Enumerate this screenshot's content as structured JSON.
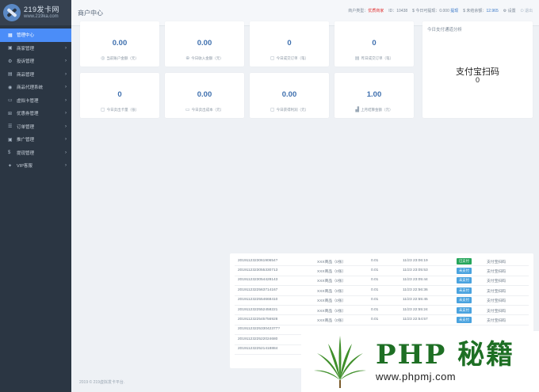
{
  "app": {
    "logo_cn": "219发卡网",
    "logo_en": "www.219ka.com",
    "page_title": "商户中心"
  },
  "header": {
    "merchant_type_label": "商户类型：",
    "merchant_type_value": "优质商家",
    "id_label": "ID：",
    "id_value": "10438",
    "withdrawable_label": "$ 今日可提现：",
    "withdrawable_value": "0.000",
    "withdraw_link": "提现",
    "unsettled_label": "$ 未结余额：",
    "unsettled_value": "12.965",
    "settings_label": "设置",
    "logout_label": "退出"
  },
  "sidebar": {
    "items": [
      {
        "icon": "▦",
        "label": "管理中心",
        "arrow": false
      },
      {
        "icon": "▣",
        "label": "商家管理",
        "arrow": true
      },
      {
        "icon": "⚙",
        "label": "投诉管理",
        "arrow": true
      },
      {
        "icon": "▤",
        "label": "商品管理",
        "arrow": true
      },
      {
        "icon": "◉",
        "label": "商品代理系统",
        "arrow": true
      },
      {
        "icon": "▭",
        "label": "虚拟卡管理",
        "arrow": true
      },
      {
        "icon": "⊞",
        "label": "优惠券管理",
        "arrow": true
      },
      {
        "icon": "☰",
        "label": "订单管理",
        "arrow": true
      },
      {
        "icon": "▣",
        "label": "推广管理",
        "arrow": true
      },
      {
        "icon": "$",
        "label": "提现管理",
        "arrow": true
      },
      {
        "icon": "✦",
        "label": "VIP客服",
        "arrow": true
      }
    ]
  },
  "stats": [
    {
      "value": "0.00",
      "label": "当前账户金额（元）",
      "icon": "◎"
    },
    {
      "value": "0.00",
      "label": "今日收入金额（元）",
      "icon": "⊕"
    },
    {
      "value": "0",
      "label": "今日成交订单（笔）",
      "icon": "▢"
    },
    {
      "value": "0",
      "label": "昨日成交订单（笔）",
      "icon": "▤"
    },
    {
      "value": "0",
      "label": "今日卖出卡量（张）",
      "icon": "▢"
    },
    {
      "value": "0.00",
      "label": "今日卖出成本（元）",
      "icon": "▭"
    },
    {
      "value": "0.00",
      "label": "今日获得利润（元）",
      "icon": "▢"
    },
    {
      "value": "1.00",
      "label": "上月结算金额（元）",
      "icon": "▟"
    }
  ],
  "pay_channel": {
    "title": "今日支付通道分析",
    "name": "支付宝扫码",
    "value": "0"
  },
  "orders": [
    {
      "id": "201911232306190654?",
      "name": "XXX商品（0张）",
      "amount": "0.01",
      "time": "11/23 23:06:19",
      "status": "已支付",
      "paid": true,
      "method": "支付宝扫码"
    },
    {
      "id": "2019112323055330713",
      "name": "XXX商品（0张）",
      "amount": "0.01",
      "time": "11/23 23:05:53",
      "status": "未支付",
      "paid": false,
      "method": "支付宝扫码"
    },
    {
      "id": "2019112323054428143",
      "name": "XXX商品（0张）",
      "amount": "0.01",
      "time": "11/23 23:05:44",
      "status": "未支付",
      "paid": false,
      "method": "支付宝扫码"
    },
    {
      "id": "2019112322563714167",
      "name": "XXX商品（0张）",
      "amount": "0.01",
      "time": "11/23 22:56:36",
      "status": "未支付",
      "paid": false,
      "method": "支付宝扫码"
    },
    {
      "id": "2019112322554668410",
      "name": "XXX商品（0张）",
      "amount": "0.01",
      "time": "11/23 22:55:45",
      "status": "未支付",
      "paid": false,
      "method": "支付宝扫码"
    },
    {
      "id": "2019112322552458221",
      "name": "XXX商品（0张）",
      "amount": "0.01",
      "time": "11/23 22:55:24",
      "status": "未支付",
      "paid": false,
      "method": "支付宝扫码"
    },
    {
      "id": "2019112322545756928",
      "name": "XXX商品（0张）",
      "amount": "0.01",
      "time": "11/23 22:54:57",
      "status": "未支付",
      "paid": false,
      "method": "支付宝扫码"
    },
    {
      "id": "2019112322533042377?",
      "name": "",
      "amount": "",
      "time": "",
      "status": "",
      "paid": false,
      "method": ""
    },
    {
      "id": "2019112322522024680",
      "name": "",
      "amount": "",
      "time": "",
      "status": "",
      "paid": false,
      "method": ""
    },
    {
      "id": "2019112322521418884",
      "name": "",
      "amount": "",
      "time": "",
      "status": "",
      "paid": false,
      "method": ""
    }
  ],
  "footer": {
    "text": "2019 © 219虚拟发卡平台."
  },
  "watermark": {
    "title": "PHP 秘籍",
    "url": "www.phpmj.com"
  }
}
